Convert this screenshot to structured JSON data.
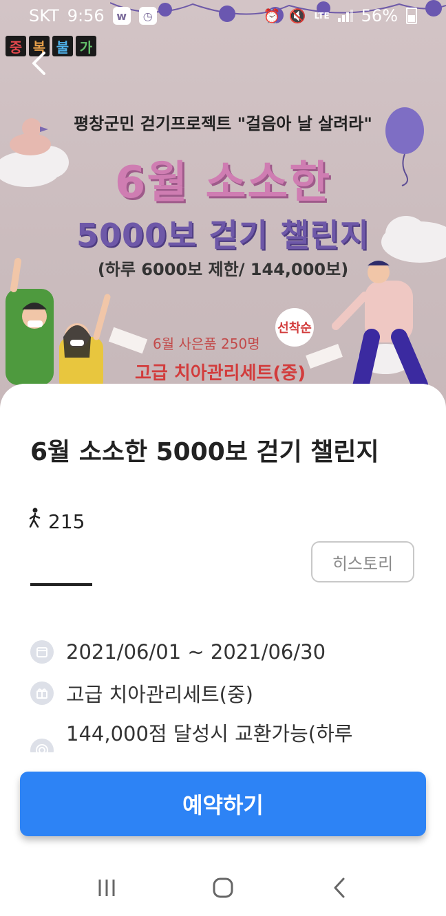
{
  "status_bar": {
    "carrier": "SKT",
    "time": "9:56",
    "network": "LTE",
    "battery": "56%",
    "icons": [
      "w-app-icon",
      "clock-app-icon",
      "alarm-icon",
      "mute-icon",
      "signal-icon",
      "battery-icon"
    ]
  },
  "banner": {
    "logo_chars": [
      "중",
      "복",
      "불",
      "가"
    ],
    "subtitle": "평창군민 걷기프로젝트 \"걸음아 날 살려라\"",
    "title_line1": "6월 소소한",
    "title_line2": "5000보 걷기 챌린지",
    "limit": "(하루 6000보 제한/ 144,000보)",
    "gift_count": "6월 사은품 250명",
    "badge": "선착순",
    "gift_name": "고급 치아관리세트(중)"
  },
  "challenge": {
    "title": "6월 소소한 5000보 걷기 챌린지",
    "steps": "215",
    "history_label": "히스토리",
    "period": "2021/06/01 ~ 2021/06/30",
    "reward": "고급 치아관리세트(중)",
    "condition": "144,000점 달성시 교환가능(하루",
    "reserve_label": "예약하기"
  },
  "colors": {
    "primary": "#2d83f5",
    "banner_bg": "#cbbcbe",
    "title_pink": "#cf7db2",
    "title_purple": "#6e58a8",
    "gift_red": "#d23c3c"
  },
  "nav": {
    "icons": [
      "recent-apps-icon",
      "home-icon",
      "back-icon"
    ]
  }
}
